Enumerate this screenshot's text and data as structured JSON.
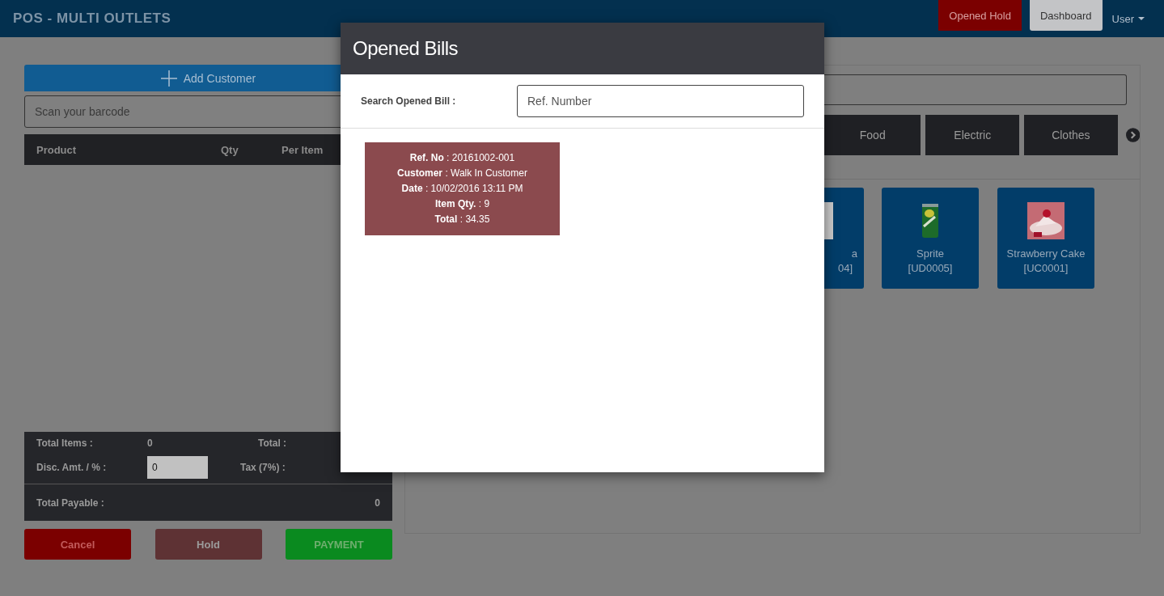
{
  "header": {
    "title": "POS - MULTI OUTLETS",
    "buttons": [
      {
        "label": "Opened Hold",
        "kind": "danger"
      },
      {
        "label": "Dashboard",
        "kind": "light"
      }
    ],
    "user_menu": "User"
  },
  "left": {
    "add_customer": "Add Customer",
    "barcode_placeholder": "Scan your barcode",
    "columns": [
      "Product",
      "Qty",
      "Per Item"
    ],
    "totals": {
      "total_items_label": "Total Items :",
      "total_items": "0",
      "total_label": "Total :",
      "disc_label": "Disc. Amt. / % :",
      "disc_value": "0",
      "tax_label": "Tax (7%) :",
      "payable_label": "Total Payable :",
      "payable": "0"
    },
    "actions": [
      {
        "label": "Cancel",
        "kind": "cancel"
      },
      {
        "label": "Hold",
        "kind": "hold"
      },
      {
        "label": "PAYMENT",
        "kind": "pay"
      }
    ]
  },
  "right": {
    "categories": [
      "Food",
      "Electric",
      "Clothes"
    ],
    "products": [
      {
        "name": "a",
        "code": "04]",
        "kind": "partial"
      },
      {
        "name": "Sprite",
        "code": "[UD0005]",
        "kind": "can"
      },
      {
        "name": "Strawberry Cake",
        "code": "[UC0001]",
        "kind": "cake"
      }
    ]
  },
  "modal": {
    "title": "Opened Bills",
    "search_label": "Search Opened Bill :",
    "search_placeholder": "Ref. Number",
    "bills": [
      {
        "lines": [
          "**Ref. No** : 20161002-001",
          "**Customer** : Walk In Customer",
          "**Date** : 10/02/2016 13:11 PM",
          "**Item Qty.** : 9",
          "**Total** : 34.35"
        ]
      }
    ]
  }
}
